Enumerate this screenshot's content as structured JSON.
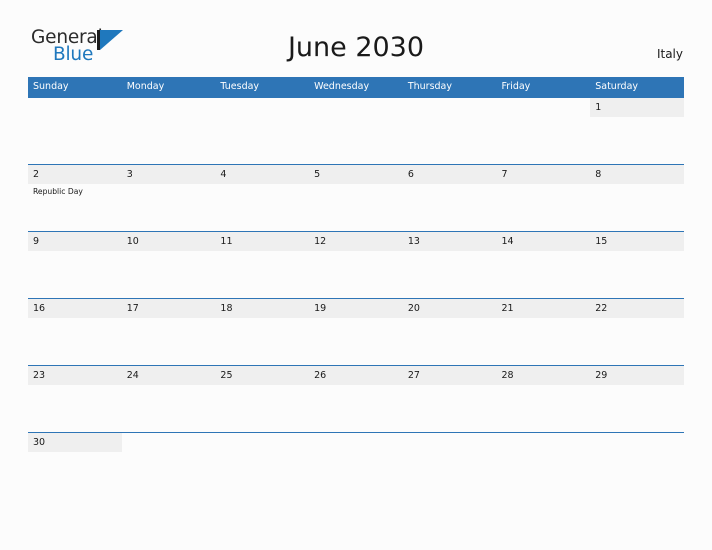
{
  "brand": {
    "name_part1": "General",
    "name_part2": "Blue",
    "flag_icon": "general-blue-flag-icon",
    "color_primary": "#1f78bd",
    "color_text": "#2b2b2b"
  },
  "header": {
    "title": "June 2030",
    "country": "Italy"
  },
  "theme": {
    "header_blue": "#2e75b6",
    "row_border_blue": "#2e75b6",
    "date_band_gray": "#efefef",
    "page_background": "#fcfcfc"
  },
  "calendar": {
    "month": "June",
    "year": "2030",
    "weekday_headers": [
      "Sunday",
      "Monday",
      "Tuesday",
      "Wednesday",
      "Thursday",
      "Friday",
      "Saturday"
    ],
    "weeks": [
      {
        "days": [
          {
            "date": "",
            "events": []
          },
          {
            "date": "",
            "events": []
          },
          {
            "date": "",
            "events": []
          },
          {
            "date": "",
            "events": []
          },
          {
            "date": "",
            "events": []
          },
          {
            "date": "",
            "events": []
          },
          {
            "date": "1",
            "events": []
          }
        ]
      },
      {
        "days": [
          {
            "date": "2",
            "events": [
              "Republic Day"
            ]
          },
          {
            "date": "3",
            "events": []
          },
          {
            "date": "4",
            "events": []
          },
          {
            "date": "5",
            "events": []
          },
          {
            "date": "6",
            "events": []
          },
          {
            "date": "7",
            "events": []
          },
          {
            "date": "8",
            "events": []
          }
        ]
      },
      {
        "days": [
          {
            "date": "9",
            "events": []
          },
          {
            "date": "10",
            "events": []
          },
          {
            "date": "11",
            "events": []
          },
          {
            "date": "12",
            "events": []
          },
          {
            "date": "13",
            "events": []
          },
          {
            "date": "14",
            "events": []
          },
          {
            "date": "15",
            "events": []
          }
        ]
      },
      {
        "days": [
          {
            "date": "16",
            "events": []
          },
          {
            "date": "17",
            "events": []
          },
          {
            "date": "18",
            "events": []
          },
          {
            "date": "19",
            "events": []
          },
          {
            "date": "20",
            "events": []
          },
          {
            "date": "21",
            "events": []
          },
          {
            "date": "22",
            "events": []
          }
        ]
      },
      {
        "days": [
          {
            "date": "23",
            "events": []
          },
          {
            "date": "24",
            "events": []
          },
          {
            "date": "25",
            "events": []
          },
          {
            "date": "26",
            "events": []
          },
          {
            "date": "27",
            "events": []
          },
          {
            "date": "28",
            "events": []
          },
          {
            "date": "29",
            "events": []
          }
        ]
      },
      {
        "days": [
          {
            "date": "30",
            "events": []
          },
          {
            "date": "",
            "events": []
          },
          {
            "date": "",
            "events": []
          },
          {
            "date": "",
            "events": []
          },
          {
            "date": "",
            "events": []
          },
          {
            "date": "",
            "events": []
          },
          {
            "date": "",
            "events": []
          }
        ]
      }
    ]
  }
}
